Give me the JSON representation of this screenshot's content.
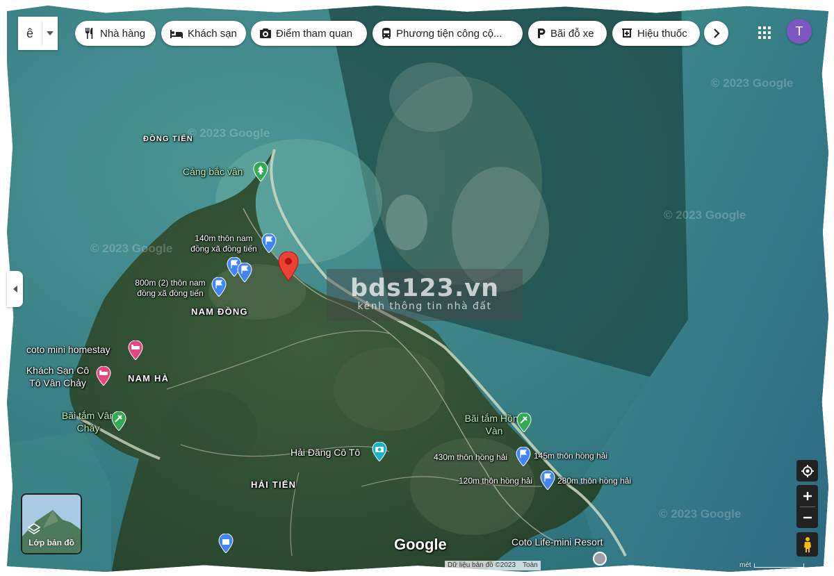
{
  "search": {
    "partial_text": "ê"
  },
  "categories": [
    {
      "label": "Nhà hàng",
      "icon": "restaurant-icon"
    },
    {
      "label": "Khách sạn",
      "icon": "hotel-icon"
    },
    {
      "label": "Điểm tham quan",
      "icon": "camera-icon"
    },
    {
      "label": "Phương tiện công cộ...",
      "icon": "transit-icon"
    },
    {
      "label": "Bãi đỗ xe",
      "icon": "parking-icon"
    },
    {
      "label": "Hiệu thuốc",
      "icon": "pharmacy-icon"
    }
  ],
  "account": {
    "avatar_letter": "T",
    "avatar_color": "#7e57c2"
  },
  "map": {
    "area_labels": {
      "dong_tien": "ĐỒNG TIẾN",
      "nam_dong": "NAM ĐỒNG",
      "nam_ha": "NAM HÀ",
      "hai_tien": "HẢI TIẾN"
    },
    "places": {
      "cang_bac_van": "Cảng bắc vân",
      "pin1": "140m thôn nam đồng xã đồng tiến",
      "pin2": "800m (2) thôn nam đồng xã đồng tiến",
      "homestay": "coto mini homestay",
      "khach_san": "Khách Sạn Cô Tô Vân Chảy",
      "bai_tam_van_chay": "Bãi tắm Vân Chảy",
      "hai_dang": "Hải Đăng Cô Tô",
      "bai_tam_hong_van": "Bãi tắm Hồng Vàn",
      "pin_430": "430m thôn hồng hải",
      "pin_145": "145m thôn hồng hải",
      "pin_120": "120m thôn hồng hải",
      "pin_280": "280m thôn hồng hải",
      "resort": "Coto Life-mini Resort"
    },
    "watermark": "© 2023 Google",
    "logo": "Google",
    "footer_data": "Dữ liệu bản đồ ©2023",
    "footer_partial": "Toàn",
    "footer_scale": "mét"
  },
  "brand_overlay": {
    "title": "bds123.vn",
    "subtitle": "kênh thông tin nhà đất"
  },
  "layers": {
    "label": "Lớp bản đồ"
  },
  "colors": {
    "pin_red": "#ea4335",
    "pin_blue": "#4285f4",
    "pin_pink": "#e8457c",
    "pin_green": "#34a853",
    "pin_teal": "#12b5cb"
  }
}
